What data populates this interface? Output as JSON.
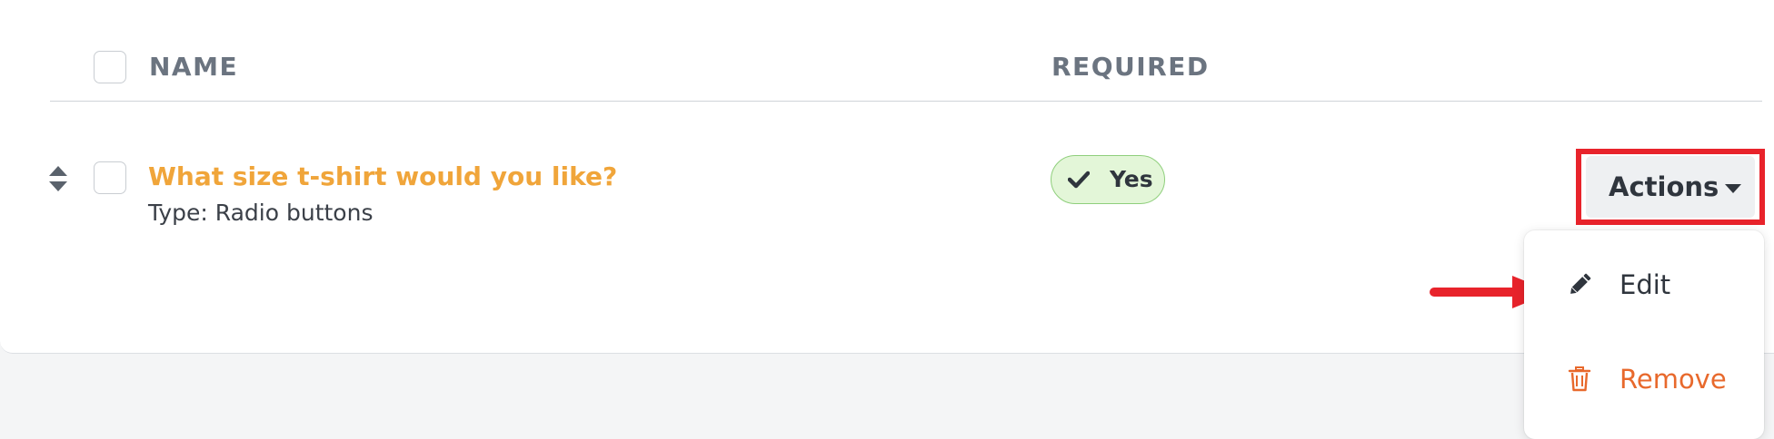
{
  "table": {
    "columns": {
      "name": "NAME",
      "required": "REQUIRED"
    },
    "rows": [
      {
        "title": "What size t-shirt would you like?",
        "type": "Type: Radio buttons",
        "required": "Yes"
      }
    ]
  },
  "actions": {
    "button_label": "Actions",
    "menu": [
      {
        "label": "Edit",
        "icon": "pencil-icon",
        "color": "#2f353d"
      },
      {
        "label": "Remove",
        "icon": "trash-icon",
        "color": "#e8692c"
      }
    ]
  },
  "colors": {
    "question_title": "#f0a53a",
    "required_badge_bg": "#e3f6d8",
    "required_badge_border": "#8fcf7c",
    "highlight": "#e8232b",
    "remove": "#e8692c"
  }
}
